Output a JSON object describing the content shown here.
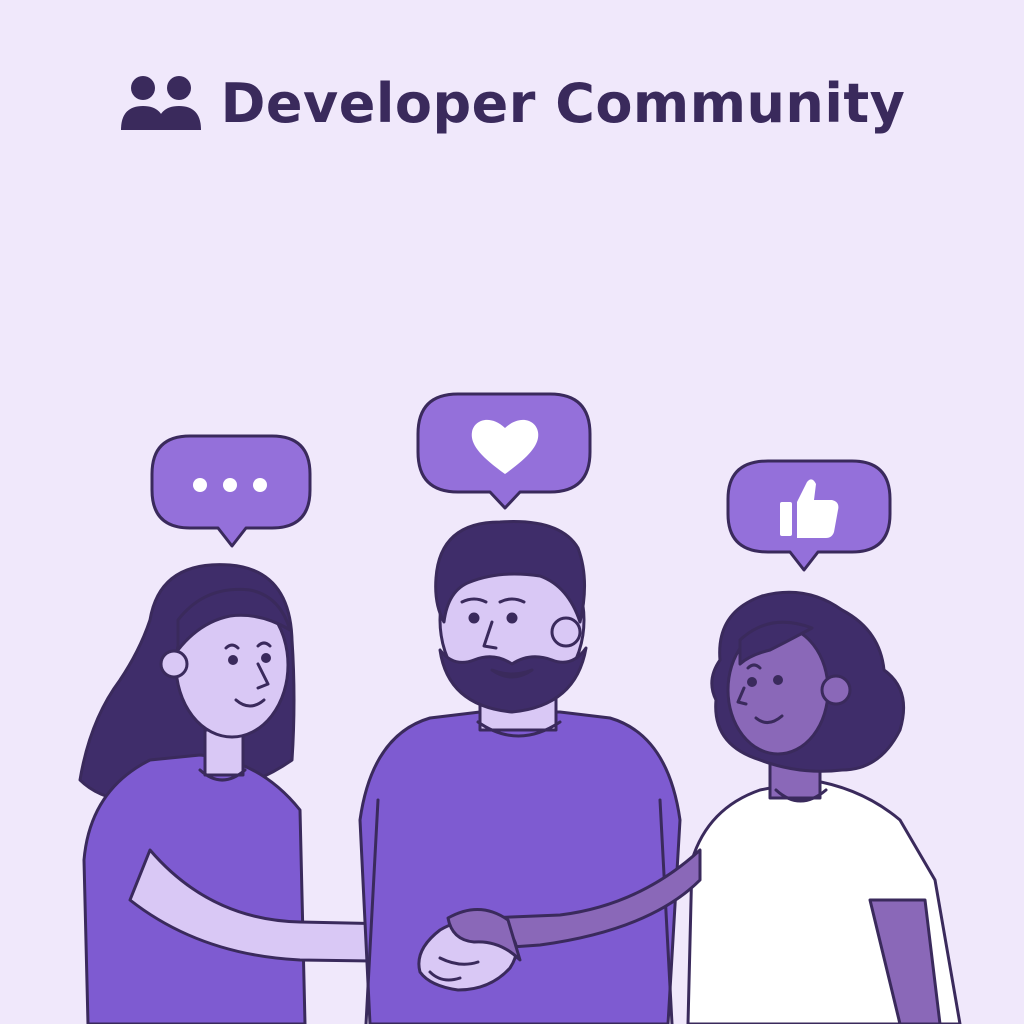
{
  "header": {
    "title": "Developer Community",
    "icon": "users-group-icon"
  },
  "bubbles": [
    {
      "icon": "ellipsis-icon"
    },
    {
      "icon": "heart-icon"
    },
    {
      "icon": "thumbs-up-icon"
    }
  ],
  "colors": {
    "background": "#f0e8fb",
    "ink": "#3a2a5c",
    "purple": "#7e5bd1",
    "bubble": "#9470da",
    "light_skin": "#d9c8f5",
    "dark_skin": "#8a68b8",
    "white": "#ffffff"
  }
}
